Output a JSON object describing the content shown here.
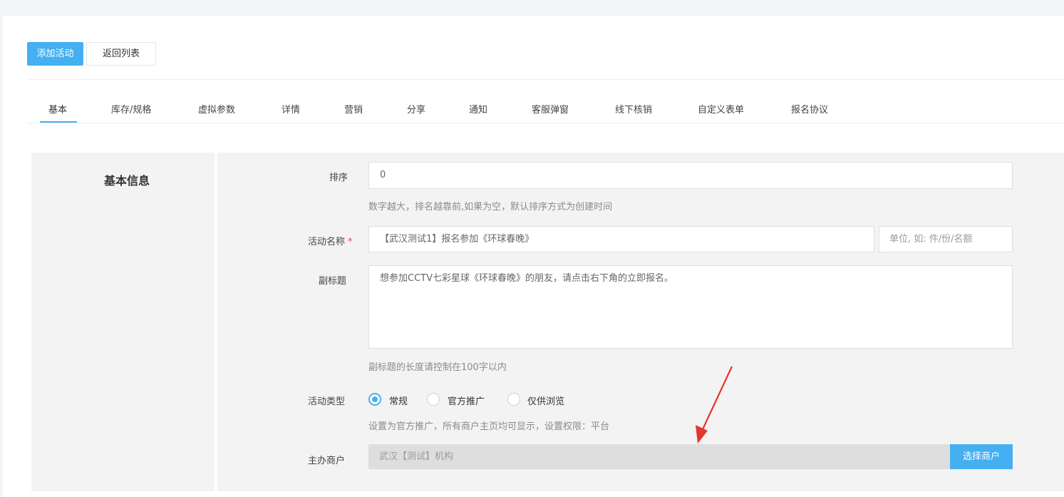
{
  "toolbar": {
    "add_label": "添加活动",
    "back_label": "返回列表"
  },
  "tabs": [
    {
      "label": "基本",
      "active": true
    },
    {
      "label": "库存/规格"
    },
    {
      "label": "虚拟参数"
    },
    {
      "label": "详情"
    },
    {
      "label": "营销"
    },
    {
      "label": "分享"
    },
    {
      "label": "通知"
    },
    {
      "label": "客服弹窗"
    },
    {
      "label": "线下核销"
    },
    {
      "label": "自定义表单"
    },
    {
      "label": "报名协议"
    }
  ],
  "section": {
    "title": "基本信息"
  },
  "form": {
    "sort": {
      "label": "排序",
      "value": "0",
      "hint": "数字越大，排名越靠前,如果为空，默认排序方式为创建时间"
    },
    "name": {
      "label": "活动名称",
      "required_mark": "*",
      "value": "【武汉测试1】报名参加《环球春晚》",
      "unit_placeholder": "单位, 如: 件/份/名额"
    },
    "subtitle": {
      "label": "副标题",
      "value": "想参加CCTV七彩星球《环球春晚》的朋友，请点击右下角的立即报名。",
      "hint": "副标题的长度请控制在100字以内"
    },
    "type": {
      "label": "活动类型",
      "options": [
        "常规",
        "官方推广",
        "仅供浏览"
      ],
      "selected": "常规",
      "hint": "设置为官方推广，所有商户主页均可显示，设置权限：平台"
    },
    "merchant": {
      "label": "主办商户",
      "value": "武汉【测试】机构",
      "button_label": "选择商户"
    }
  },
  "colors": {
    "accent": "#44b0f1",
    "required": "#e84a4a",
    "annotation_arrow": "#e8342b"
  }
}
